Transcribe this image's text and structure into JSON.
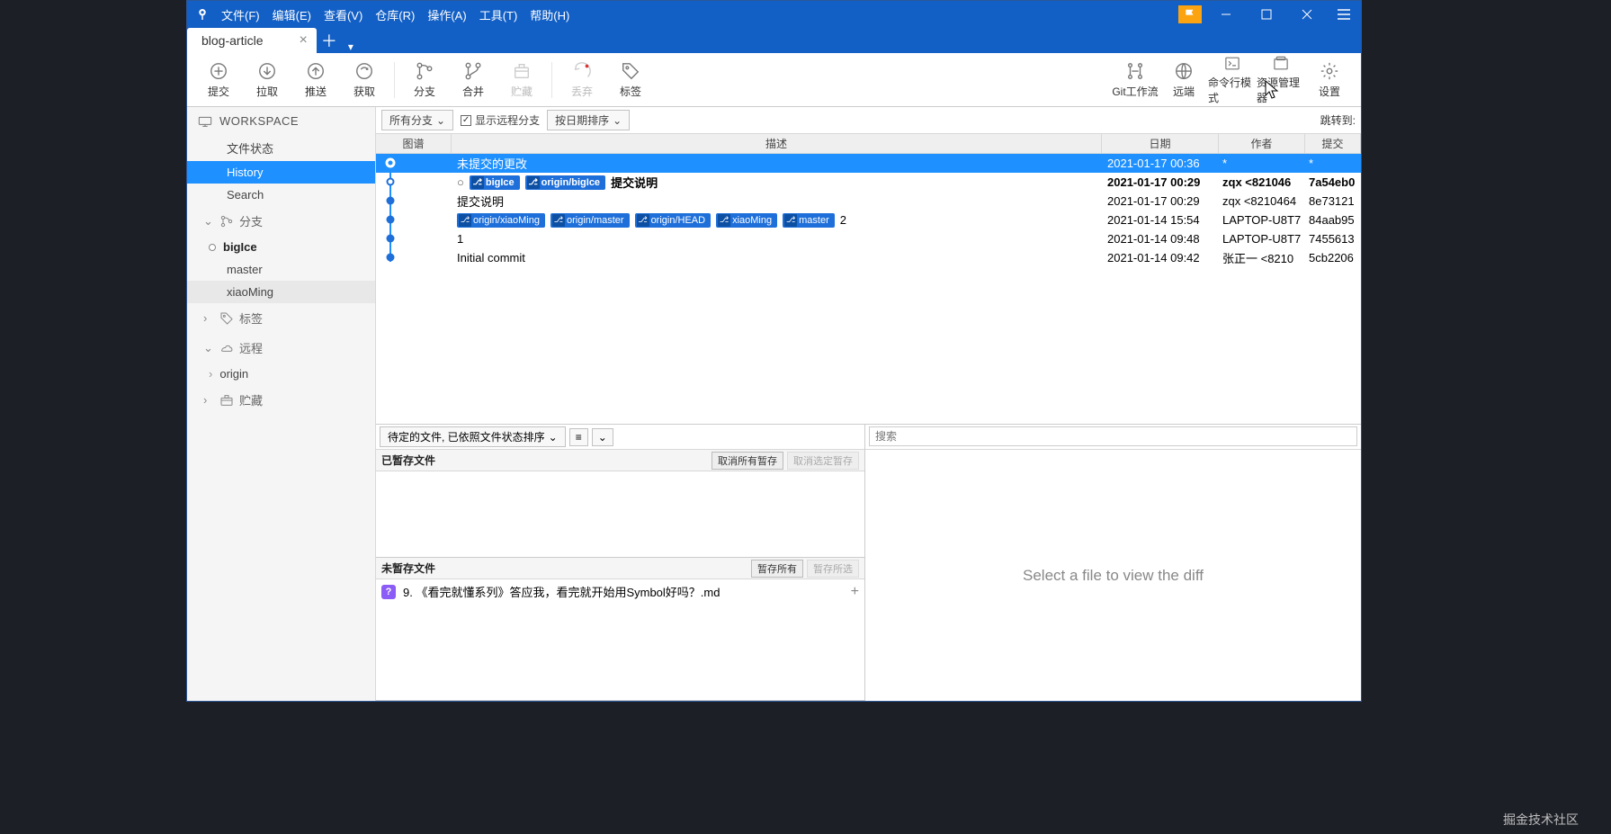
{
  "menus": [
    "文件(F)",
    "编辑(E)",
    "查看(V)",
    "仓库(R)",
    "操作(A)",
    "工具(T)",
    "帮助(H)"
  ],
  "tab": {
    "title": "blog-article"
  },
  "toolbar": [
    {
      "id": "commit",
      "label": "提交",
      "disabled": false
    },
    {
      "id": "pull",
      "label": "拉取",
      "disabled": false
    },
    {
      "id": "push",
      "label": "推送",
      "disabled": false
    },
    {
      "id": "fetch",
      "label": "获取",
      "disabled": false
    },
    {
      "sep": true
    },
    {
      "id": "branch",
      "label": "分支",
      "disabled": false
    },
    {
      "id": "merge",
      "label": "合并",
      "disabled": false
    },
    {
      "id": "stash",
      "label": "贮藏",
      "disabled": true
    },
    {
      "sep": true
    },
    {
      "id": "discard",
      "label": "丢弃",
      "disabled": true
    },
    {
      "id": "tag",
      "label": "标签",
      "disabled": false
    }
  ],
  "toolbar_right": [
    {
      "id": "gitflow",
      "label": "Git工作流"
    },
    {
      "id": "remote",
      "label": "远端"
    },
    {
      "id": "terminal",
      "label": "命令行模式"
    },
    {
      "id": "explorer",
      "label": "资源管理器"
    },
    {
      "id": "settings",
      "label": "设置"
    }
  ],
  "sidebar": {
    "workspace_label": "WORKSPACE",
    "workspace_items": [
      "文件状态",
      "History",
      "Search"
    ],
    "branches_label": "分支",
    "branches": [
      {
        "name": "bigIce",
        "current": true
      },
      {
        "name": "master",
        "current": false
      },
      {
        "name": "xiaoMing",
        "current": false
      }
    ],
    "tags_label": "标签",
    "remotes_label": "远程",
    "remotes": [
      "origin"
    ],
    "stashes_label": "贮藏"
  },
  "filter": {
    "all_branches": "所有分支",
    "show_remote": "显示远程分支",
    "sort_date": "按日期排序",
    "jumpto": "跳转到:"
  },
  "columns": {
    "graph": "图谱",
    "desc": "描述",
    "date": "日期",
    "author": "作者",
    "commit": "提交"
  },
  "commits": [
    {
      "desc": "未提交的更改",
      "tags": [],
      "date": "2021-01-17 00:36",
      "author": "*",
      "hash": "*",
      "selected": true,
      "nodeType": "pending"
    },
    {
      "desc": "提交说明",
      "tags": [
        "bigIce",
        "origin/bigIce"
      ],
      "date": "2021-01-17 00:29",
      "author": "zqx <821046",
      "hash": "7a54eb0",
      "bold": true,
      "nodeType": "head"
    },
    {
      "desc": "提交说明",
      "tags": [],
      "date": "2021-01-17 00:29",
      "author": "zqx <8210464",
      "hash": "8e73121"
    },
    {
      "desc": "2",
      "tags": [
        "origin/xiaoMing",
        "origin/master",
        "origin/HEAD",
        "xiaoMing",
        "master"
      ],
      "date": "2021-01-14 15:54",
      "author": "LAPTOP-U8T7",
      "hash": "84aab95"
    },
    {
      "desc": "1",
      "tags": [],
      "date": "2021-01-14 09:48",
      "author": "LAPTOP-U8T7",
      "hash": "7455613"
    },
    {
      "desc": "Initial commit",
      "tags": [],
      "date": "2021-01-14 09:42",
      "author": "张正一 <8210",
      "hash": "5cb2206"
    }
  ],
  "detail": {
    "pending_sort": "待定的文件, 已依照文件状态排序",
    "staged_label": "已暂存文件",
    "unstage_all": "取消所有暂存",
    "unstage_sel": "取消选定暂存",
    "unstaged_label": "未暂存文件",
    "stage_all": "暂存所有",
    "stage_sel": "暂存所选",
    "file": "9. 《看完就懂系列》答应我，看完就开始用Symbol好吗？.md",
    "search_placeholder": "搜索",
    "diff_placeholder": "Select a file to view the diff"
  },
  "watermark": "掘金技术社区"
}
